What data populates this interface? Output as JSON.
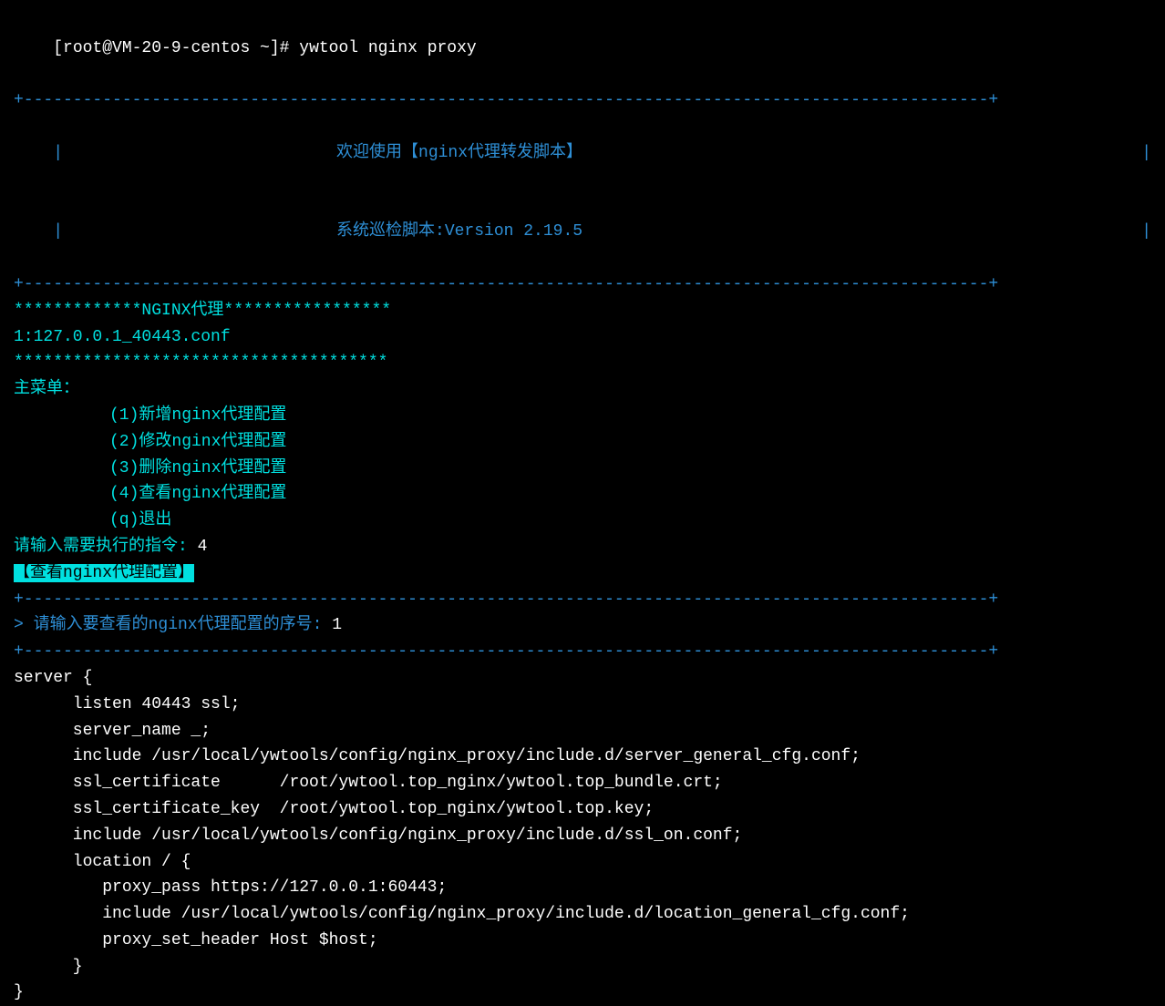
{
  "prompt": "[root@VM-20-9-centos ~]# ",
  "command": "ywtool nginx proxy",
  "box_top": "+--------------------------------------------------------------------------------------------------+",
  "box_side": "|",
  "welcome_title": "欢迎使用【nginx代理转发脚本】",
  "version_line": "系统巡检脚本:Version 2.19.5",
  "box_bottom": "+--------------------------------------------------------------------------------------------------+",
  "stars_header": "*************NGINX代理*****************",
  "config_file": "1:127.0.0.1_40443.conf",
  "stars_divider": "**************************************",
  "main_menu": "主菜单：",
  "menu_items": {
    "1": "(1)新增nginx代理配置",
    "2": "(2)修改nginx代理配置",
    "3": "(3)删除nginx代理配置",
    "4": "(4)查看nginx代理配置",
    "q": "(q)退出"
  },
  "input_command_prompt": "请输入需要执行的指令: ",
  "input_command_value": "4",
  "view_config_label": "【查看nginx代理配置】",
  "divider_line": "+--------------------------------------------------------------------------------------------------+",
  "serial_prompt": "> 请输入要查看的nginx代理配置的序号: ",
  "serial_value": "1",
  "nginx_config": {
    "line1": "server {",
    "line2": "      listen 40443 ssl;",
    "line3": "      server_name _;",
    "line4": "",
    "line5": "      include /usr/local/ywtools/config/nginx_proxy/include.d/server_general_cfg.conf;",
    "line6": "      ssl_certificate      /root/ywtool.top_nginx/ywtool.top_bundle.crt;",
    "line7": "      ssl_certificate_key  /root/ywtool.top_nginx/ywtool.top.key;",
    "line8": "      include /usr/local/ywtools/config/nginx_proxy/include.d/ssl_on.conf;",
    "line9": "",
    "line10": "      location / {",
    "line11": "         proxy_pass https://127.0.0.1:60443;",
    "line12": "         include /usr/local/ywtools/config/nginx_proxy/include.d/location_general_cfg.conf;",
    "line13": "         proxy_set_header Host $host;",
    "line14": "      }",
    "line15": "}"
  }
}
